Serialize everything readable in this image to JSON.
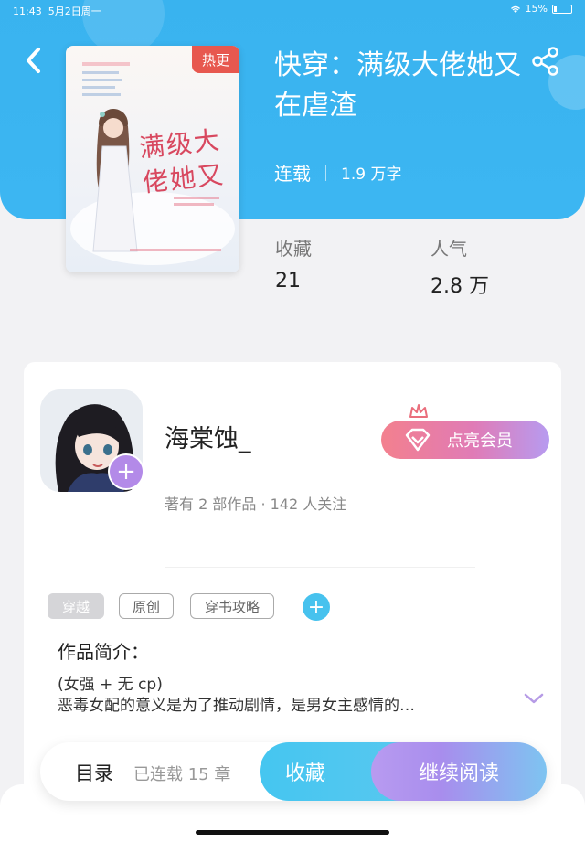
{
  "status_bar": {
    "time": "11:43",
    "date": "5月2日周一",
    "battery": "15%"
  },
  "book": {
    "badge": "热更",
    "cover_title": "满级大佬她又",
    "title": "快穿：满级大佬她又在虐渣",
    "status": "连载",
    "word_count": "1.9 万字",
    "stats": [
      {
        "label": "收藏",
        "value": "21"
      },
      {
        "label": "人气",
        "value": "2.8 万"
      }
    ]
  },
  "author": {
    "name": "海棠蚀_",
    "meta": "著有 2 部作品 · 142 人关注",
    "vip_label": "点亮会员"
  },
  "tags": [
    "穿越",
    "原创",
    "穿书攻略"
  ],
  "intro": {
    "label": "作品简介：",
    "line1": "(女强 + 无 cp)",
    "line2": "恶毒女配的意义是为了推动剧情，是男女主感情的…"
  },
  "bottom": {
    "toc_label": "目录",
    "chapters": "已连载 15 章",
    "collect_label": "收藏",
    "read_label": "继续阅读"
  },
  "icons": {
    "back": "chevron-left-icon",
    "share": "share-icon",
    "vip": "diamond-icon",
    "crown": "crown-icon",
    "add": "plus-icon",
    "expand": "chevron-down-icon"
  }
}
